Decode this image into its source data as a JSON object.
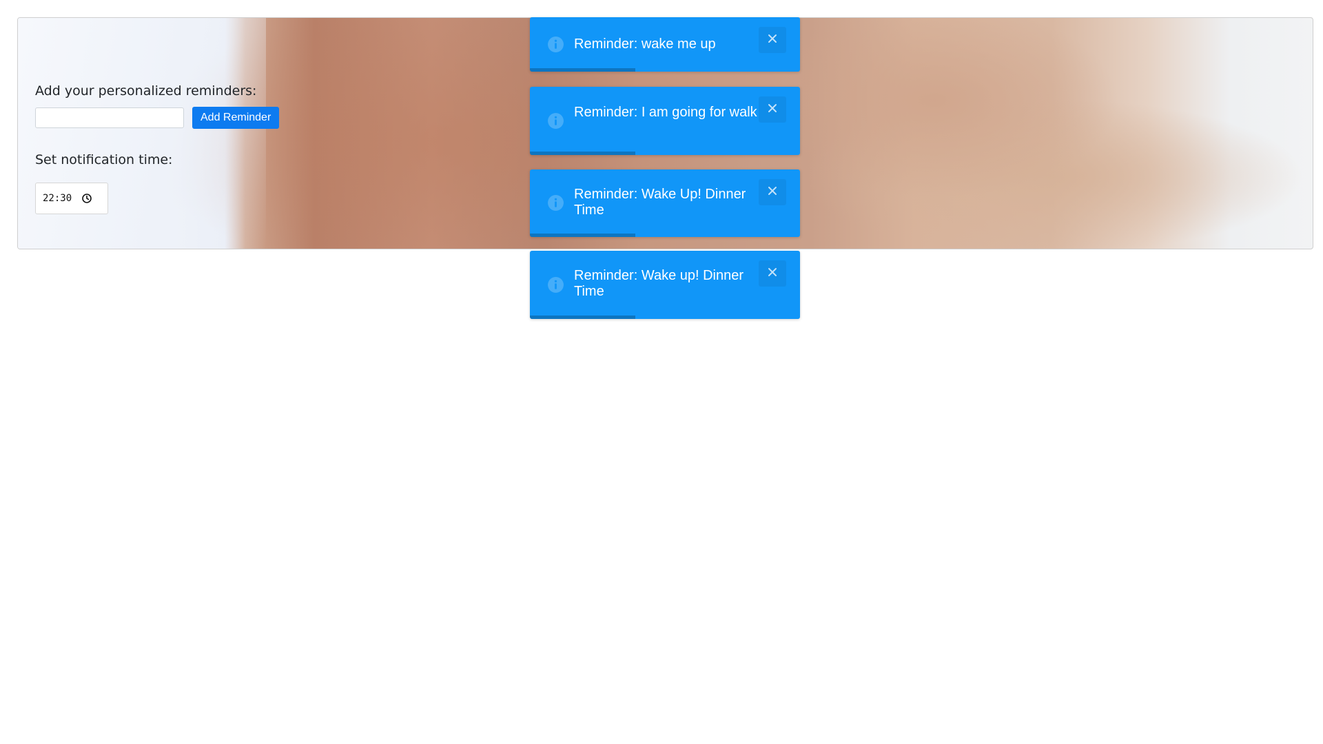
{
  "form": {
    "reminders_label": "Add your personalized reminders:",
    "reminder_input_value": "",
    "add_button_label": "Add Reminder",
    "time_label": "Set notification time:",
    "time_value": "22:30",
    "time_icon": "clock-icon"
  },
  "toasts": [
    {
      "message": "Reminder: wake me up",
      "icon": "info-icon",
      "close_icon": "close-icon",
      "progress": 0.39
    },
    {
      "message": "Reminder: I am going for walk",
      "icon": "info-icon",
      "close_icon": "close-icon",
      "progress": 0.39
    },
    {
      "message": "Reminder: Wake Up! Dinner Time",
      "icon": "info-icon",
      "close_icon": "close-icon",
      "progress": 0.39
    },
    {
      "message": "Reminder: Wake up! Dinner Time",
      "icon": "info-icon",
      "close_icon": "close-icon",
      "progress": 0.39
    }
  ],
  "colors": {
    "toast_bg": "#1196f8",
    "button_bg": "#0d7bf0",
    "text": "#212529"
  }
}
